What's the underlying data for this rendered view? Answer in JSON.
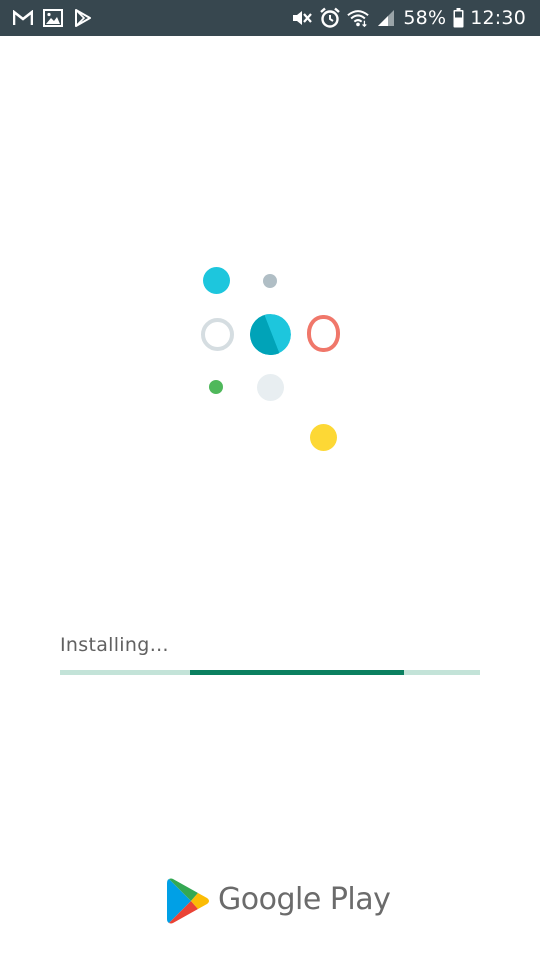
{
  "status_bar": {
    "left_icons": [
      "gmail-icon",
      "gallery-icon",
      "play-store-notification-icon"
    ],
    "right_icons": [
      "mute-icon",
      "alarm-icon",
      "wifi-icon",
      "signal-icon",
      "battery-icon"
    ],
    "battery_percent": "58%",
    "time": "12:30"
  },
  "loading_animation": {
    "colors": {
      "cyan": "#1dc6dd",
      "teal_dark": "#00a3b8",
      "grey": "#b0bec5",
      "ring_grey": "#d5dde1",
      "ring_red": "#f0776a",
      "green": "#4fb85b",
      "pale": "#e8eef1",
      "yellow": "#fdd835"
    }
  },
  "install": {
    "status_text": "Installing…",
    "progress_fraction_start": 0.31,
    "progress_fraction_end": 0.82,
    "colors": {
      "track": "#c3e3d8",
      "fill": "#0b8060"
    }
  },
  "footer": {
    "brand": "Google Play"
  }
}
